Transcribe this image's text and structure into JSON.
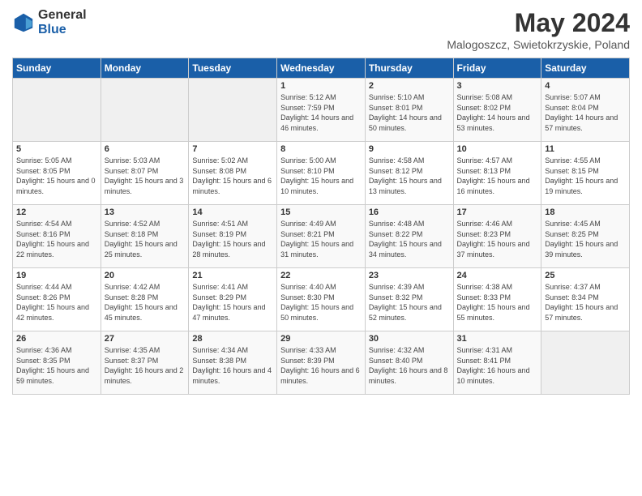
{
  "logo": {
    "general": "General",
    "blue": "Blue"
  },
  "title": "May 2024",
  "subtitle": "Malogoszcz, Swietokrzyskie, Poland",
  "weekdays": [
    "Sunday",
    "Monday",
    "Tuesday",
    "Wednesday",
    "Thursday",
    "Friday",
    "Saturday"
  ],
  "weeks": [
    [
      {
        "day": "",
        "sunrise": "",
        "sunset": "",
        "daylight": ""
      },
      {
        "day": "",
        "sunrise": "",
        "sunset": "",
        "daylight": ""
      },
      {
        "day": "",
        "sunrise": "",
        "sunset": "",
        "daylight": ""
      },
      {
        "day": "1",
        "sunrise": "Sunrise: 5:12 AM",
        "sunset": "Sunset: 7:59 PM",
        "daylight": "Daylight: 14 hours and 46 minutes."
      },
      {
        "day": "2",
        "sunrise": "Sunrise: 5:10 AM",
        "sunset": "Sunset: 8:01 PM",
        "daylight": "Daylight: 14 hours and 50 minutes."
      },
      {
        "day": "3",
        "sunrise": "Sunrise: 5:08 AM",
        "sunset": "Sunset: 8:02 PM",
        "daylight": "Daylight: 14 hours and 53 minutes."
      },
      {
        "day": "4",
        "sunrise": "Sunrise: 5:07 AM",
        "sunset": "Sunset: 8:04 PM",
        "daylight": "Daylight: 14 hours and 57 minutes."
      }
    ],
    [
      {
        "day": "5",
        "sunrise": "Sunrise: 5:05 AM",
        "sunset": "Sunset: 8:05 PM",
        "daylight": "Daylight: 15 hours and 0 minutes."
      },
      {
        "day": "6",
        "sunrise": "Sunrise: 5:03 AM",
        "sunset": "Sunset: 8:07 PM",
        "daylight": "Daylight: 15 hours and 3 minutes."
      },
      {
        "day": "7",
        "sunrise": "Sunrise: 5:02 AM",
        "sunset": "Sunset: 8:08 PM",
        "daylight": "Daylight: 15 hours and 6 minutes."
      },
      {
        "day": "8",
        "sunrise": "Sunrise: 5:00 AM",
        "sunset": "Sunset: 8:10 PM",
        "daylight": "Daylight: 15 hours and 10 minutes."
      },
      {
        "day": "9",
        "sunrise": "Sunrise: 4:58 AM",
        "sunset": "Sunset: 8:12 PM",
        "daylight": "Daylight: 15 hours and 13 minutes."
      },
      {
        "day": "10",
        "sunrise": "Sunrise: 4:57 AM",
        "sunset": "Sunset: 8:13 PM",
        "daylight": "Daylight: 15 hours and 16 minutes."
      },
      {
        "day": "11",
        "sunrise": "Sunrise: 4:55 AM",
        "sunset": "Sunset: 8:15 PM",
        "daylight": "Daylight: 15 hours and 19 minutes."
      }
    ],
    [
      {
        "day": "12",
        "sunrise": "Sunrise: 4:54 AM",
        "sunset": "Sunset: 8:16 PM",
        "daylight": "Daylight: 15 hours and 22 minutes."
      },
      {
        "day": "13",
        "sunrise": "Sunrise: 4:52 AM",
        "sunset": "Sunset: 8:18 PM",
        "daylight": "Daylight: 15 hours and 25 minutes."
      },
      {
        "day": "14",
        "sunrise": "Sunrise: 4:51 AM",
        "sunset": "Sunset: 8:19 PM",
        "daylight": "Daylight: 15 hours and 28 minutes."
      },
      {
        "day": "15",
        "sunrise": "Sunrise: 4:49 AM",
        "sunset": "Sunset: 8:21 PM",
        "daylight": "Daylight: 15 hours and 31 minutes."
      },
      {
        "day": "16",
        "sunrise": "Sunrise: 4:48 AM",
        "sunset": "Sunset: 8:22 PM",
        "daylight": "Daylight: 15 hours and 34 minutes."
      },
      {
        "day": "17",
        "sunrise": "Sunrise: 4:46 AM",
        "sunset": "Sunset: 8:23 PM",
        "daylight": "Daylight: 15 hours and 37 minutes."
      },
      {
        "day": "18",
        "sunrise": "Sunrise: 4:45 AM",
        "sunset": "Sunset: 8:25 PM",
        "daylight": "Daylight: 15 hours and 39 minutes."
      }
    ],
    [
      {
        "day": "19",
        "sunrise": "Sunrise: 4:44 AM",
        "sunset": "Sunset: 8:26 PM",
        "daylight": "Daylight: 15 hours and 42 minutes."
      },
      {
        "day": "20",
        "sunrise": "Sunrise: 4:42 AM",
        "sunset": "Sunset: 8:28 PM",
        "daylight": "Daylight: 15 hours and 45 minutes."
      },
      {
        "day": "21",
        "sunrise": "Sunrise: 4:41 AM",
        "sunset": "Sunset: 8:29 PM",
        "daylight": "Daylight: 15 hours and 47 minutes."
      },
      {
        "day": "22",
        "sunrise": "Sunrise: 4:40 AM",
        "sunset": "Sunset: 8:30 PM",
        "daylight": "Daylight: 15 hours and 50 minutes."
      },
      {
        "day": "23",
        "sunrise": "Sunrise: 4:39 AM",
        "sunset": "Sunset: 8:32 PM",
        "daylight": "Daylight: 15 hours and 52 minutes."
      },
      {
        "day": "24",
        "sunrise": "Sunrise: 4:38 AM",
        "sunset": "Sunset: 8:33 PM",
        "daylight": "Daylight: 15 hours and 55 minutes."
      },
      {
        "day": "25",
        "sunrise": "Sunrise: 4:37 AM",
        "sunset": "Sunset: 8:34 PM",
        "daylight": "Daylight: 15 hours and 57 minutes."
      }
    ],
    [
      {
        "day": "26",
        "sunrise": "Sunrise: 4:36 AM",
        "sunset": "Sunset: 8:35 PM",
        "daylight": "Daylight: 15 hours and 59 minutes."
      },
      {
        "day": "27",
        "sunrise": "Sunrise: 4:35 AM",
        "sunset": "Sunset: 8:37 PM",
        "daylight": "Daylight: 16 hours and 2 minutes."
      },
      {
        "day": "28",
        "sunrise": "Sunrise: 4:34 AM",
        "sunset": "Sunset: 8:38 PM",
        "daylight": "Daylight: 16 hours and 4 minutes."
      },
      {
        "day": "29",
        "sunrise": "Sunrise: 4:33 AM",
        "sunset": "Sunset: 8:39 PM",
        "daylight": "Daylight: 16 hours and 6 minutes."
      },
      {
        "day": "30",
        "sunrise": "Sunrise: 4:32 AM",
        "sunset": "Sunset: 8:40 PM",
        "daylight": "Daylight: 16 hours and 8 minutes."
      },
      {
        "day": "31",
        "sunrise": "Sunrise: 4:31 AM",
        "sunset": "Sunset: 8:41 PM",
        "daylight": "Daylight: 16 hours and 10 minutes."
      },
      {
        "day": "",
        "sunrise": "",
        "sunset": "",
        "daylight": ""
      }
    ]
  ]
}
